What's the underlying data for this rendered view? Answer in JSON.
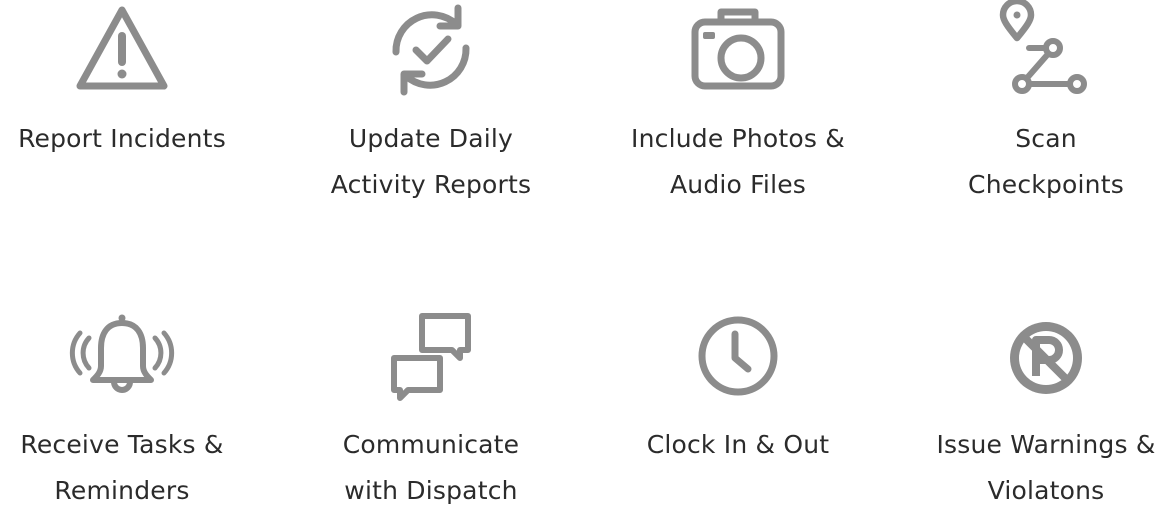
{
  "features": [
    {
      "label": "Report Incidents",
      "icon": "warning-triangle-icon"
    },
    {
      "label": "Update Daily\nActivity Reports",
      "icon": "sync-check-icon"
    },
    {
      "label": "Include Photos &\nAudio Files",
      "icon": "camera-icon"
    },
    {
      "label": "Scan\nCheckpoints",
      "icon": "route-checkpoint-icon"
    },
    {
      "label": "Receive Tasks &\nReminders",
      "icon": "ringing-bell-icon"
    },
    {
      "label": "Communicate\nwith Dispatch",
      "icon": "chat-bubbles-icon"
    },
    {
      "label": "Clock In & Out",
      "icon": "clock-icon"
    },
    {
      "label": "Issue Warnings &\nViolatons",
      "icon": "no-parking-icon"
    }
  ],
  "colors": {
    "icon": "#8c8c8c",
    "text": "#2b2b2b",
    "background": "#ffffff"
  }
}
